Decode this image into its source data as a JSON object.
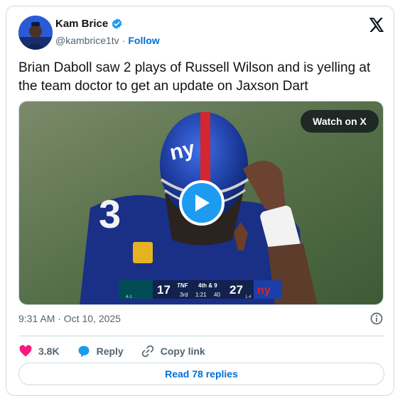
{
  "author": {
    "name": "Kam Brice",
    "handle": "@kambrice1tv",
    "separator": "·",
    "follow_label": "Follow",
    "verified": true
  },
  "tweet": {
    "text": "Brian Daboll saw 2 plays of Russell Wilson and is yelling at the team doctor to get an update on Jaxson Dart",
    "timestamp": "9:31 AM · Oct 10, 2025"
  },
  "media": {
    "watch_label": "Watch on X",
    "jersey_number": "3",
    "helmet_logo": "ny",
    "scorebug": {
      "home_score": "17",
      "network": "TNF",
      "down_distance": "4th & 9",
      "quarter": "3rd",
      "clock": "1:21",
      "play_clock": "40",
      "away_score": "27",
      "away_logo": "ny",
      "home_record": "4-1",
      "away_record": "1-4"
    }
  },
  "actions": {
    "likes_count": "3.8K",
    "reply_label": "Reply",
    "copy_link_label": "Copy link"
  },
  "read_replies_label": "Read 78 replies",
  "colors": {
    "accent": "#1d9bf0",
    "link": "#006fd6",
    "like": "#f91880",
    "muted": "#536471",
    "border": "#cfd9de"
  },
  "icons": [
    "x-logo-icon",
    "verified-badge-icon",
    "play-icon",
    "info-icon",
    "heart-icon",
    "reply-bubble-icon",
    "link-icon"
  ]
}
